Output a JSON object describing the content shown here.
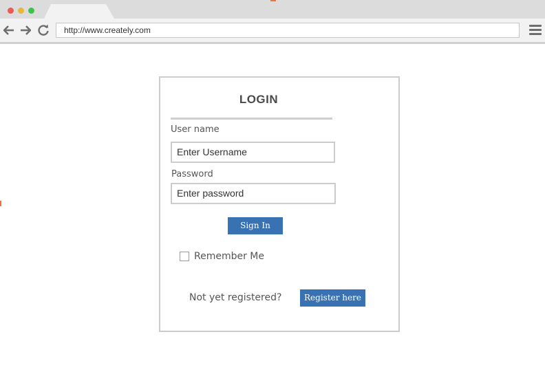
{
  "browser": {
    "address": "http://www.creately.com",
    "icons": {
      "back": "arrow-left-icon",
      "forward": "arrow-right-icon",
      "reload": "reload-icon",
      "menu": "hamburger-menu-icon"
    },
    "window_controls": {
      "close_color": "#ee5a52",
      "minimize_color": "#e9b53a",
      "maximize_color": "#3fc14b"
    }
  },
  "login": {
    "title": "LOGIN",
    "username_label": "User name",
    "username_value": "Enter Username",
    "password_label": "Password",
    "password_value": "Enter password",
    "sign_in_label": "Sign In",
    "remember_label": "Remember Me",
    "remember_checked": false,
    "not_registered_text": "Not yet registered?",
    "register_label": "Register here"
  },
  "colors": {
    "accent": "#3872b3",
    "border": "#cccccc",
    "text": "#555555"
  }
}
